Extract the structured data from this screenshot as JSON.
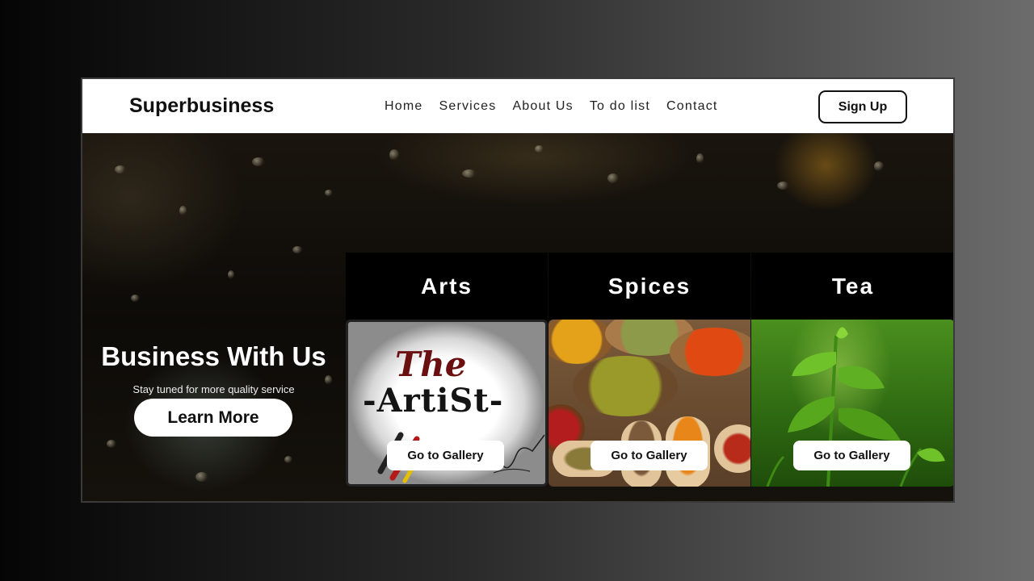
{
  "header": {
    "brand": "Superbusiness",
    "nav": [
      "Home",
      "Services",
      "About Us",
      "To do list",
      "Contact"
    ],
    "signup_label": "Sign Up"
  },
  "hero": {
    "title": "Business With Us",
    "subtitle": "Stay tuned for more quality service",
    "cta_label": "Learn More"
  },
  "cards": [
    {
      "title": "Arts",
      "button": "Go to Gallery",
      "image_text_1": "The",
      "image_text_2": "-ArtiSt-"
    },
    {
      "title": "Spices",
      "button": "Go to Gallery"
    },
    {
      "title": "Tea",
      "button": "Go to Gallery"
    }
  ],
  "colors": {
    "nav_bg": "#ffffff",
    "brand_text": "#111111",
    "card_header_bg": "#000000",
    "button_bg": "#ffffff"
  }
}
